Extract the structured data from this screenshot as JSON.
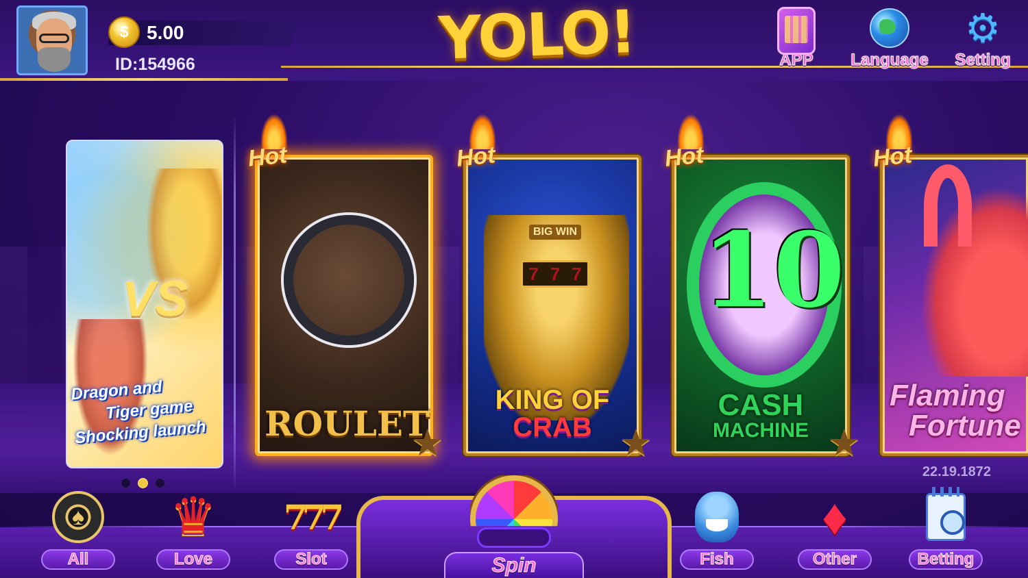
{
  "header": {
    "balance": "5.00",
    "user_id": "ID:154966",
    "logo": "YOLO!",
    "coin_symbol": "$",
    "buttons": {
      "app": "APP",
      "language": "Language",
      "setting": "Setting"
    }
  },
  "banner": {
    "vs_text": "VS",
    "caption_lines": [
      "Dragon and",
      "Tiger game",
      "Shocking launch"
    ],
    "slides_total": 3,
    "active_slide": 2
  },
  "games": [
    {
      "title": "ROULETTE",
      "badge": "Hot",
      "highlighted": true
    },
    {
      "title_line1": "KING OF",
      "title_line2": "CRAB",
      "badge": "Hot",
      "big_win": "BIG WIN",
      "reels": [
        "7",
        "7",
        "7"
      ]
    },
    {
      "number": "10",
      "title_line1": "CASH",
      "title_line2": "MACHINE",
      "badge": "Hot"
    },
    {
      "title_line1": "Flaming",
      "title_line2": "Fortune",
      "badge": "Hot"
    }
  ],
  "version": "22.19.1872",
  "bottom_nav": {
    "all": "All",
    "love": "Love",
    "slot": "Slot",
    "spin": "Spin",
    "fish": "Fish",
    "other": "Other",
    "betting": "Betting"
  },
  "colors": {
    "background": "#2a0c63",
    "gold": "#d9a63c",
    "nav_label_text": "#ff6ad8",
    "active_dot": "#f4c742"
  }
}
